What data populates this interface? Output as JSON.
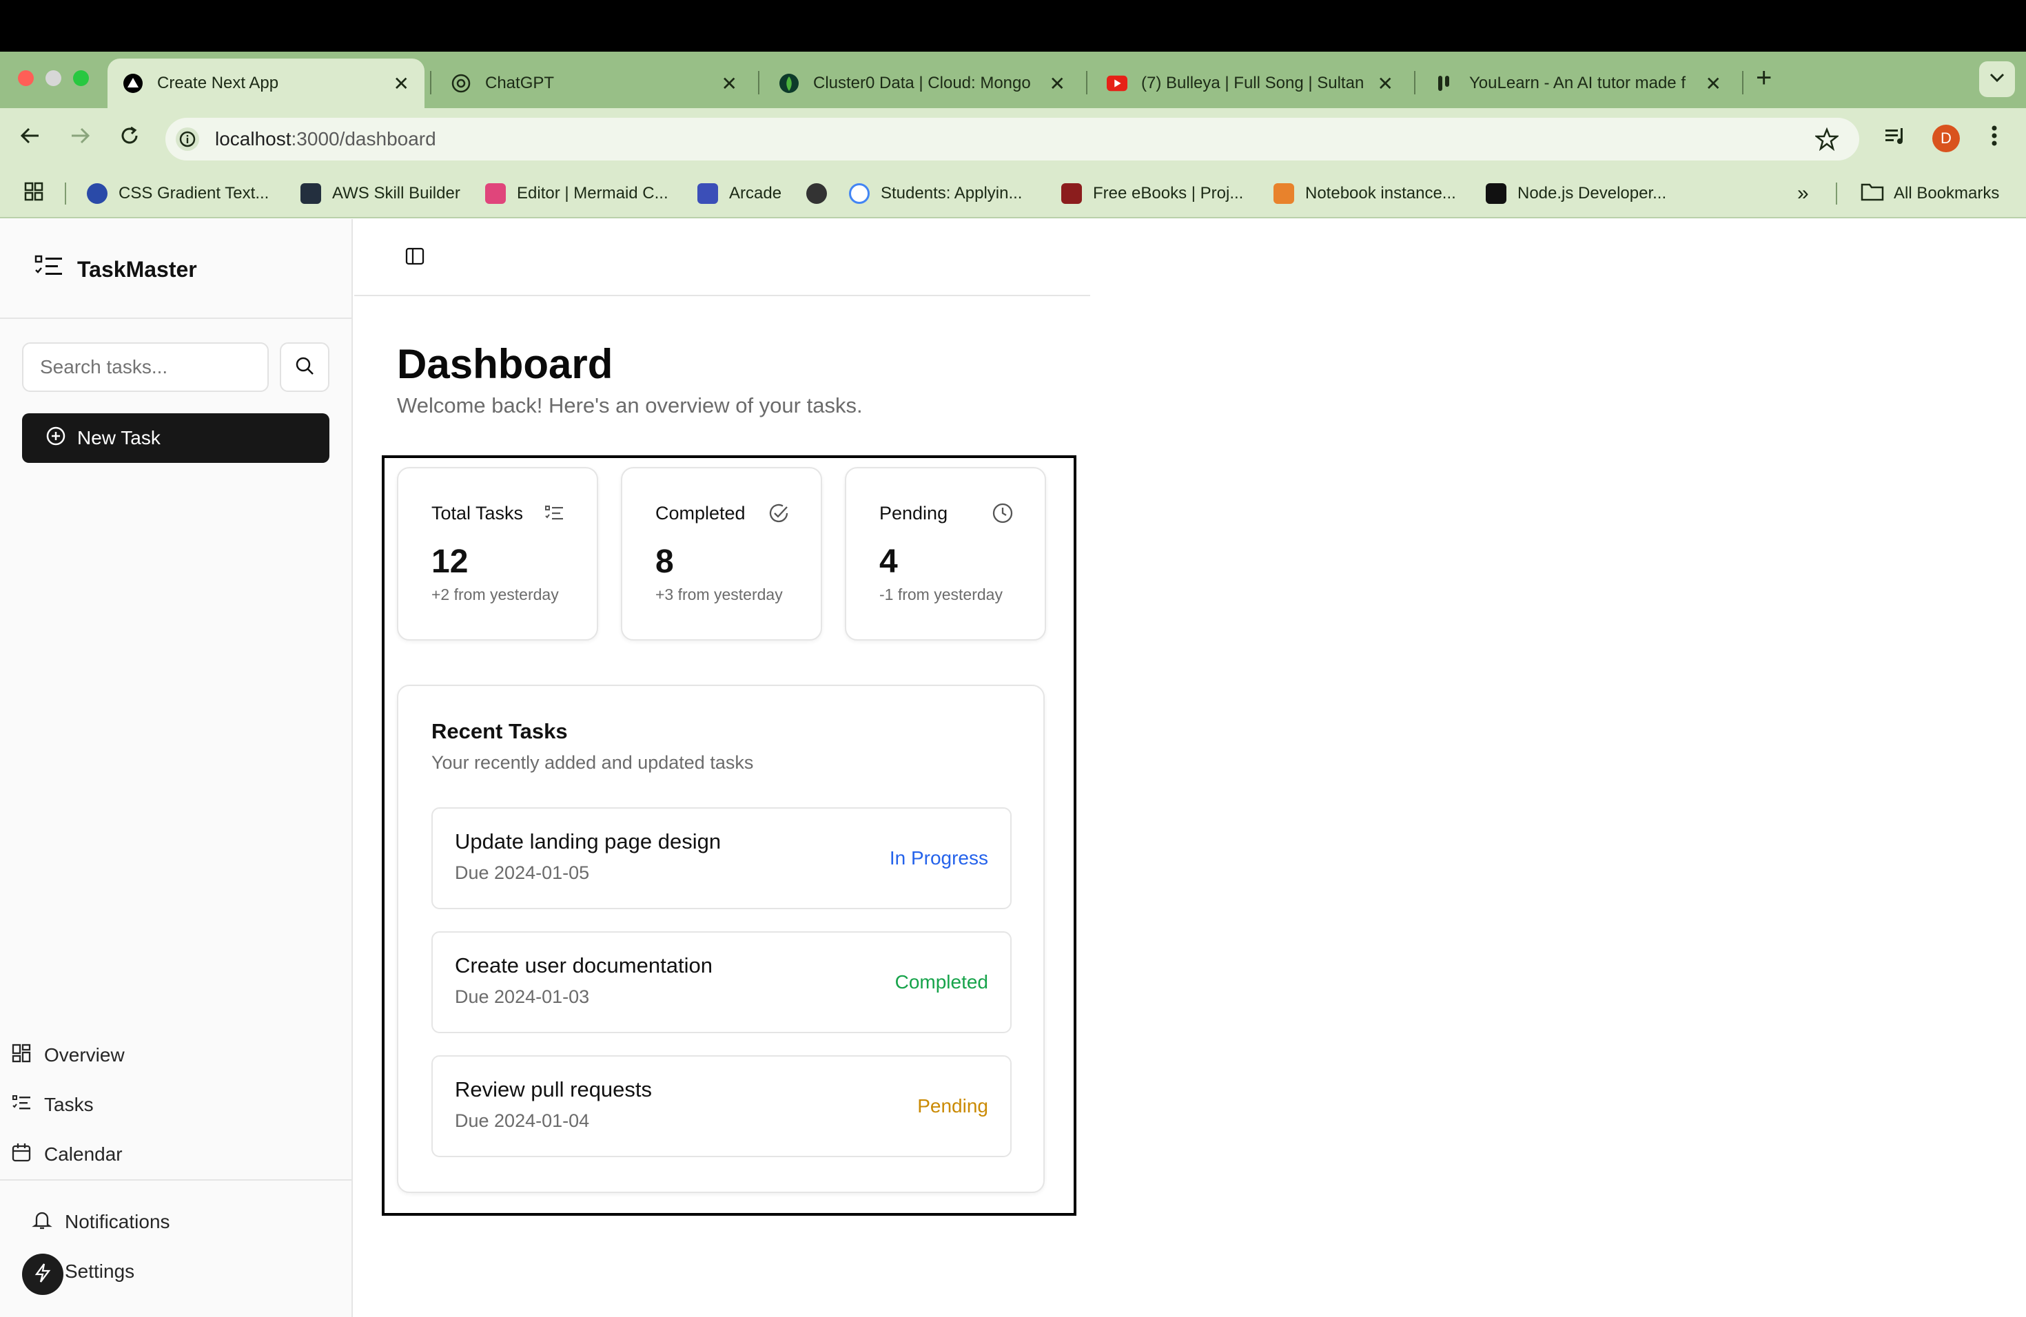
{
  "browser": {
    "tabs": [
      {
        "title": "Create Next App",
        "favicon": "nextjs-icon",
        "active": true
      },
      {
        "title": "ChatGPT",
        "favicon": "openai-icon",
        "active": false
      },
      {
        "title": "Cluster0 Data | Cloud: Mongo",
        "favicon": "mongodb-icon",
        "active": false
      },
      {
        "title": "(7) Bulleya | Full Song | Sultan",
        "favicon": "youtube-icon",
        "active": false
      },
      {
        "title": "YouLearn - An AI tutor made f",
        "favicon": "youlearn-icon",
        "active": false
      }
    ],
    "new_tab_label": "+",
    "close_label": "✕",
    "url_host": "localhost",
    "url_path": ":3000/dashboard",
    "profile_initial": "D",
    "bookmarks": [
      {
        "label": "CSS Gradient Text...",
        "icon": "css-gradient-icon",
        "color": "#2a4aa8"
      },
      {
        "label": "AWS Skill Builder",
        "icon": "aws-icon",
        "color": "#232f3e"
      },
      {
        "label": "Editor | Mermaid C...",
        "icon": "mermaid-icon",
        "color": "#e0457b"
      },
      {
        "label": "Arcade",
        "icon": "arcade-icon",
        "color": "#3b4fb8"
      },
      {
        "label": "",
        "icon": "globe-icon",
        "color": "#333333"
      },
      {
        "label": "Students: Applyin...",
        "icon": "google-icon",
        "color": "#ffffff"
      },
      {
        "label": "Free eBooks | Proj...",
        "icon": "gutenberg-icon",
        "color": "#8b1d1d"
      },
      {
        "label": "Notebook instance...",
        "icon": "sagemaker-icon",
        "color": "#e8822c"
      },
      {
        "label": "Node.js Developer...",
        "icon": "nodejs-icon",
        "color": "#111111"
      }
    ],
    "all_bookmarks_label": "All Bookmarks"
  },
  "sidebar": {
    "brand": "TaskMaster",
    "search_placeholder": "Search tasks...",
    "new_task_label": "New Task",
    "nav": [
      {
        "label": "Overview",
        "icon": "grid-icon"
      },
      {
        "label": "Tasks",
        "icon": "list-icon"
      },
      {
        "label": "Calendar",
        "icon": "calendar-icon"
      }
    ],
    "footer": [
      {
        "label": "Notifications",
        "icon": "bell-icon"
      },
      {
        "label": "Settings",
        "icon": "gear-icon"
      }
    ]
  },
  "main": {
    "title": "Dashboard",
    "subtitle": "Welcome back! Here's an overview of your tasks.",
    "stats": [
      {
        "label": "Total Tasks",
        "value": "12",
        "change": "+2 from yesterday",
        "icon": "list-check-icon"
      },
      {
        "label": "Completed",
        "value": "8",
        "change": "+3 from yesterday",
        "icon": "check-circle-icon"
      },
      {
        "label": "Pending",
        "value": "4",
        "change": "-1 from yesterday",
        "icon": "clock-icon"
      }
    ],
    "recent": {
      "title": "Recent Tasks",
      "subtitle": "Your recently added and updated tasks",
      "tasks": [
        {
          "name": "Update landing page design",
          "due": "Due 2024-01-05",
          "status": "In Progress",
          "status_color": "#2563eb"
        },
        {
          "name": "Create user documentation",
          "due": "Due 2024-01-03",
          "status": "Completed",
          "status_color": "#16a34a"
        },
        {
          "name": "Review pull requests",
          "due": "Due 2024-01-04",
          "status": "Pending",
          "status_color": "#ca8a04"
        }
      ]
    }
  },
  "colors": {
    "tabbar": "#98bf87",
    "toolbar": "#dbeacd",
    "primary_button": "#171717"
  }
}
